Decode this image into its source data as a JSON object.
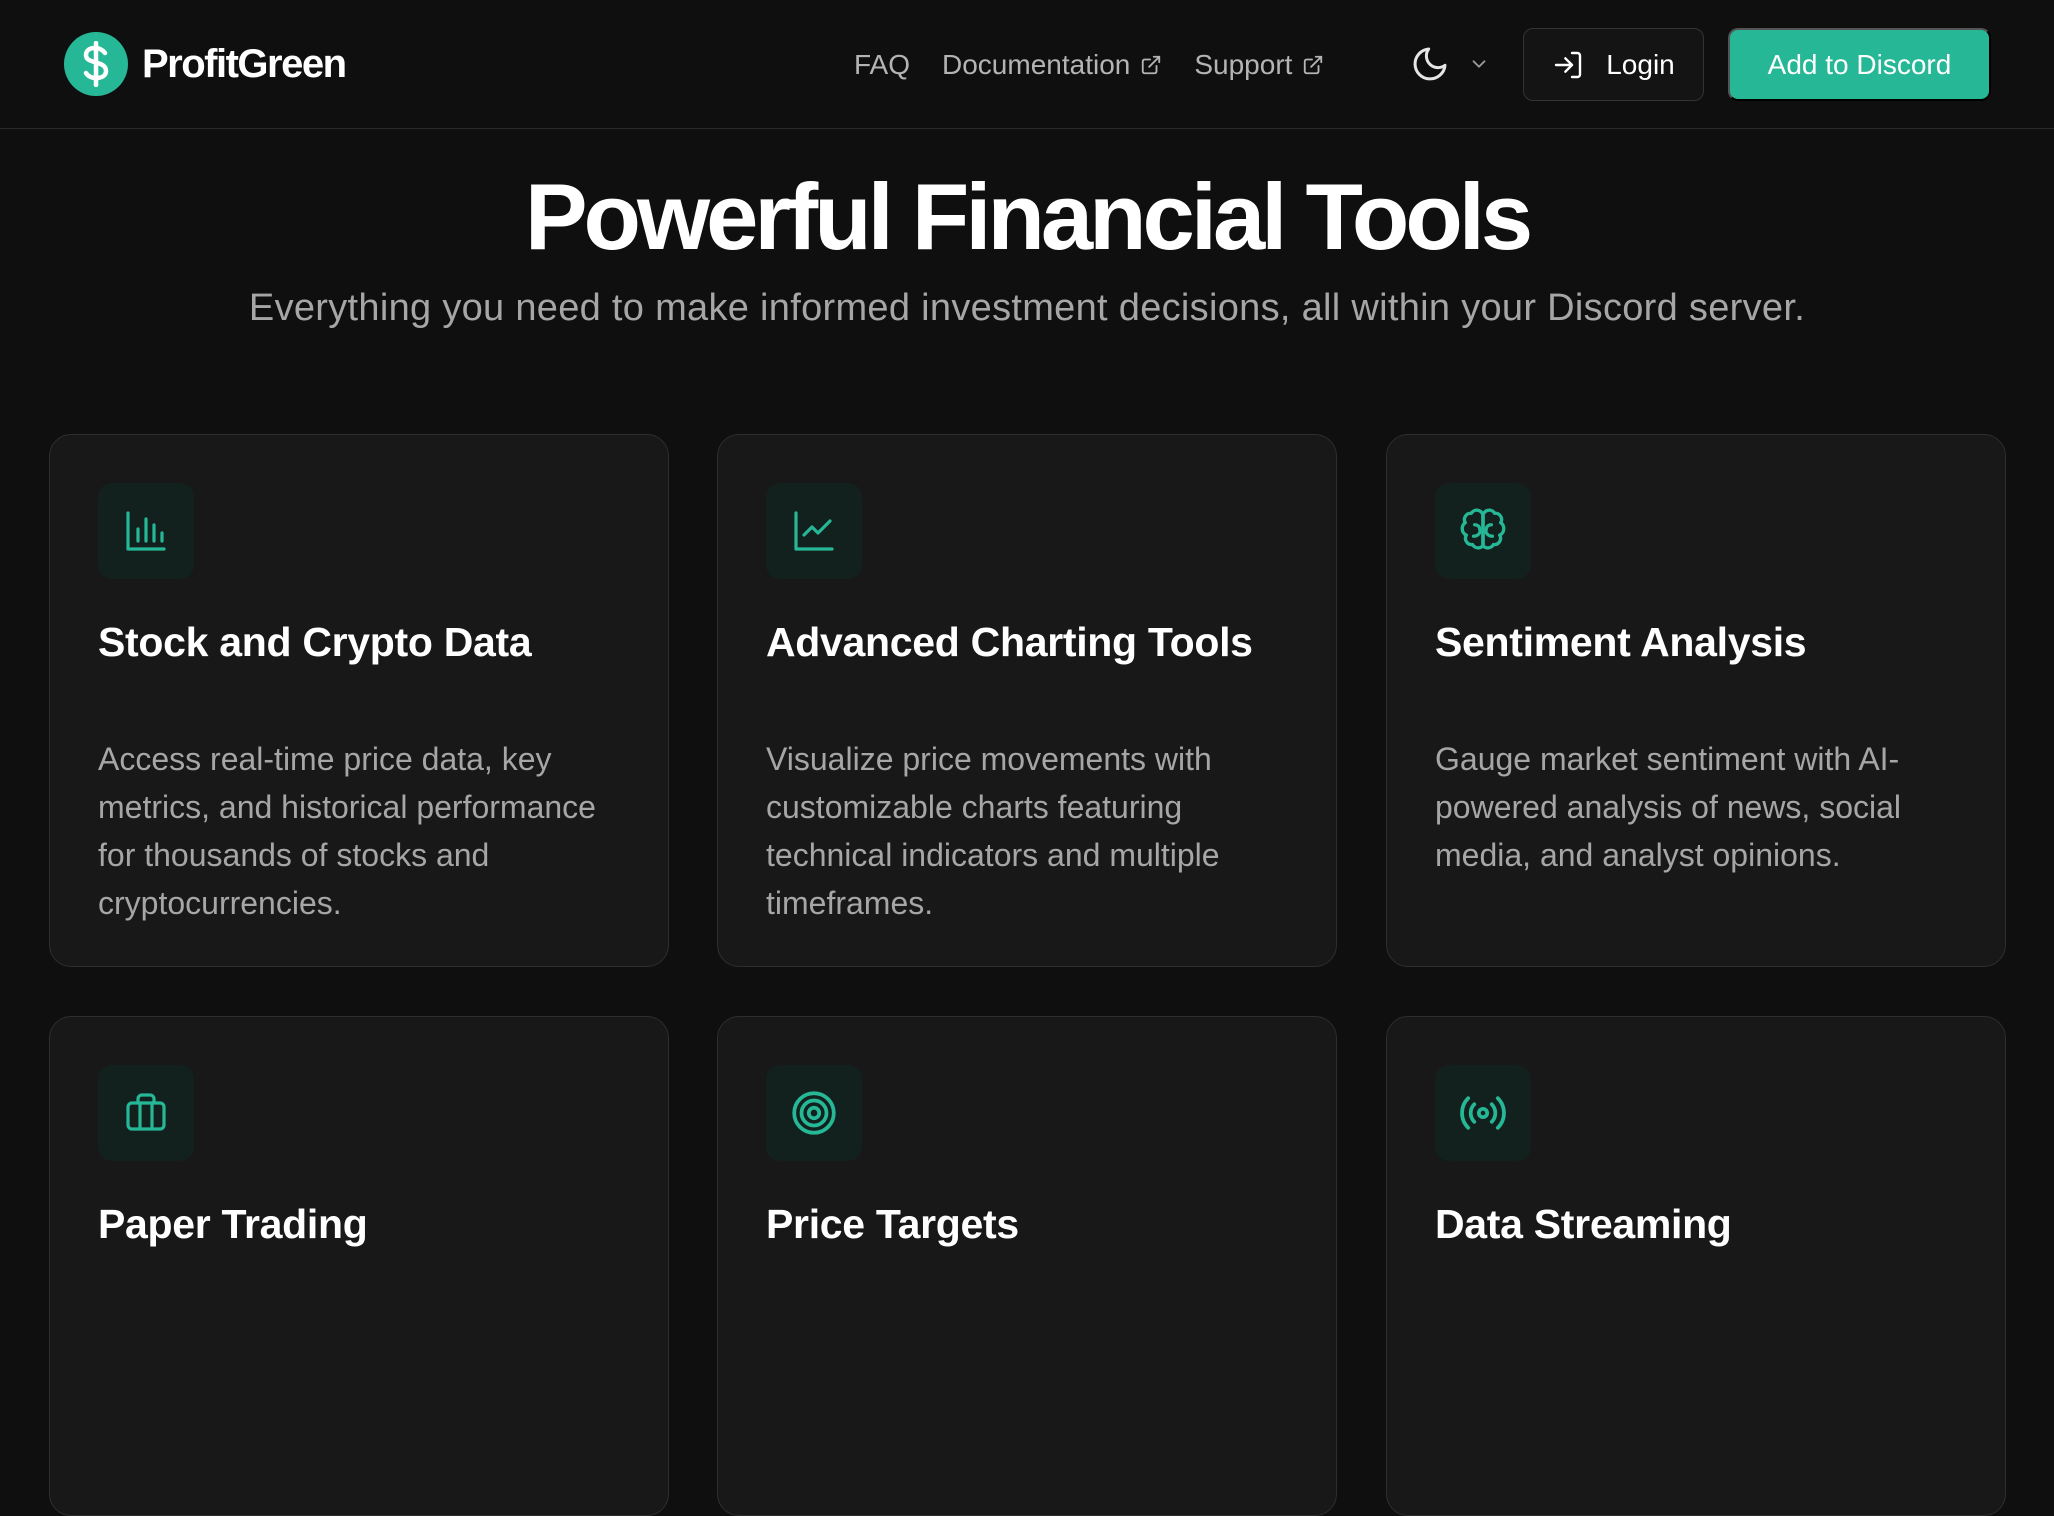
{
  "header": {
    "brand_name": "ProfitGreen",
    "nav": {
      "faq": "FAQ",
      "documentation": "Documentation",
      "support": "Support"
    },
    "login_label": "Login",
    "discord_label": "Add to Discord"
  },
  "hero": {
    "title": "Powerful Financial Tools",
    "subtitle": "Everything you need to make informed investment decisions, all within your Discord server."
  },
  "features": [
    {
      "icon": "bar-chart-icon",
      "title": "Stock and Crypto Data",
      "description": "Access real-time price data, key metrics, and historical performance for thousands of stocks and cryptocurrencies."
    },
    {
      "icon": "line-chart-icon",
      "title": "Advanced Charting Tools",
      "description": "Visualize price movements with customizable charts featuring technical indicators and multiple timeframes."
    },
    {
      "icon": "brain-icon",
      "title": "Sentiment Analysis",
      "description": "Gauge market sentiment with AI-powered analysis of news, social media, and analyst opinions."
    },
    {
      "icon": "briefcase-icon",
      "title": "Paper Trading",
      "description": ""
    },
    {
      "icon": "target-icon",
      "title": "Price Targets",
      "description": ""
    },
    {
      "icon": "radio-broadcast-icon",
      "title": "Data Streaming",
      "description": ""
    }
  ],
  "colors": {
    "accent": "#26b896",
    "background": "#0f0f0f",
    "card": "#181818"
  }
}
